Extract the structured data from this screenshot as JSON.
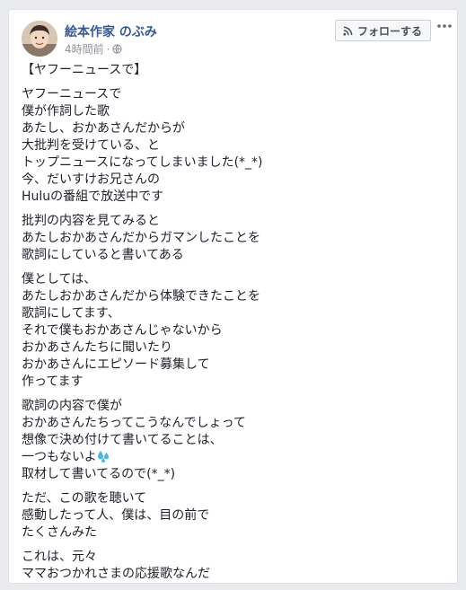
{
  "post": {
    "author": "絵本作家 のぶみ",
    "time": "4時間前",
    "separator": "·",
    "follow_label": "フォローする",
    "heading": "【ヤフーニュースで】",
    "paragraphs": [
      [
        "ヤフーニュースで",
        "僕が作詞した歌",
        "あたし、おかあさんだからが",
        "大批判を受けている、と",
        "トップニュースになってしまいました(*_*)",
        "今、だいすけお兄さんの",
        "Huluの番組で放送中です"
      ],
      [
        "批判の内容を見てみると",
        "あたしおかあさんだからガマンしたことを",
        "歌詞にしていると書いてある"
      ],
      [
        "僕としては、",
        "あたしおかあさんだから体験できたことを",
        "歌詞にしてます、",
        "それで僕もおかあさんじゃないから",
        "おかあさんたちに聞いたり",
        "おかあさんにエピソード募集して",
        "作ってます"
      ],
      [
        "歌詞の内容で僕が",
        "おかあさんたちってこうなんでしょって",
        "想像で決め付けて書いてることは、",
        "一つもないよ",
        "取材して書いてるので(*_*)"
      ],
      [
        "ただ、この歌を聴いて",
        "感動したって人、僕は、目の前で",
        "たくさんみた"
      ],
      [
        "これは、元々",
        "ママおつかれさまの応援歌なんだ"
      ]
    ]
  },
  "icons": {
    "globe": "globe-icon",
    "rss": "rss-icon",
    "more": "more-dots-icon",
    "sweat": "sweat-drops-emoji"
  },
  "colors": {
    "author_link": "#365899",
    "meta_text": "#90949c",
    "body_text": "#1d2129",
    "background": "#e9ebee",
    "emoji_blue": "#4fb6ec"
  }
}
